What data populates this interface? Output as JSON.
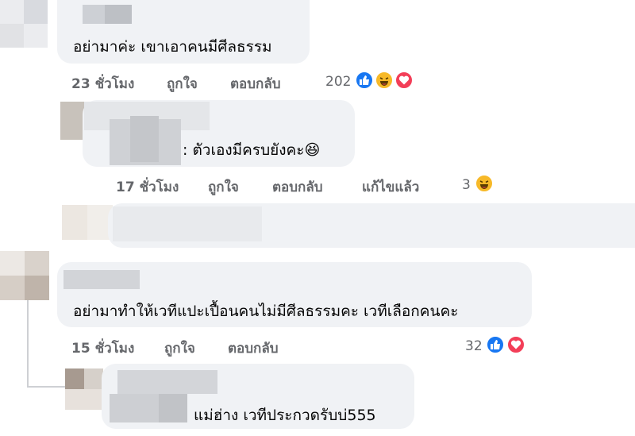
{
  "comments": [
    {
      "text": "อย่ามาค่ะ เขาเอาคนมีศีลธรรม",
      "time": "23 ชั่วโมง",
      "like": "ถูกใจ",
      "reply": "ตอบกลับ",
      "reaction_count": "202",
      "reactions": [
        "like-icon",
        "haha-icon",
        "love-icon"
      ]
    },
    {
      "text": ": ตัวเองมีครบยังคะ😆",
      "time": "17 ชั่วโมง",
      "like": "ถูกใจ",
      "reply": "ตอบกลับ",
      "edited": "แก้ไขแล้ว",
      "reaction_count": "3",
      "reactions": [
        "haha-icon"
      ]
    },
    {
      "text": "อย่ามาทำให้เวทีแปะเปื้อนคนไม่มีศีลธรรมคะ เวทีเลือกคนคะ",
      "time": "15 ชั่วโมง",
      "like": "ถูกใจ",
      "reply": "ตอบกลับ",
      "reaction_count": "32",
      "reactions": [
        "like-icon",
        "love-icon"
      ]
    },
    {
      "text": "แม่ฮ่าง เวทีประกวดรับบ่555"
    }
  ],
  "colors": {
    "bubble": "#f0f2f5",
    "meta_text": "#65676b",
    "like": "#1877f2",
    "haha": "#f7b928",
    "love": "#f33e58"
  }
}
